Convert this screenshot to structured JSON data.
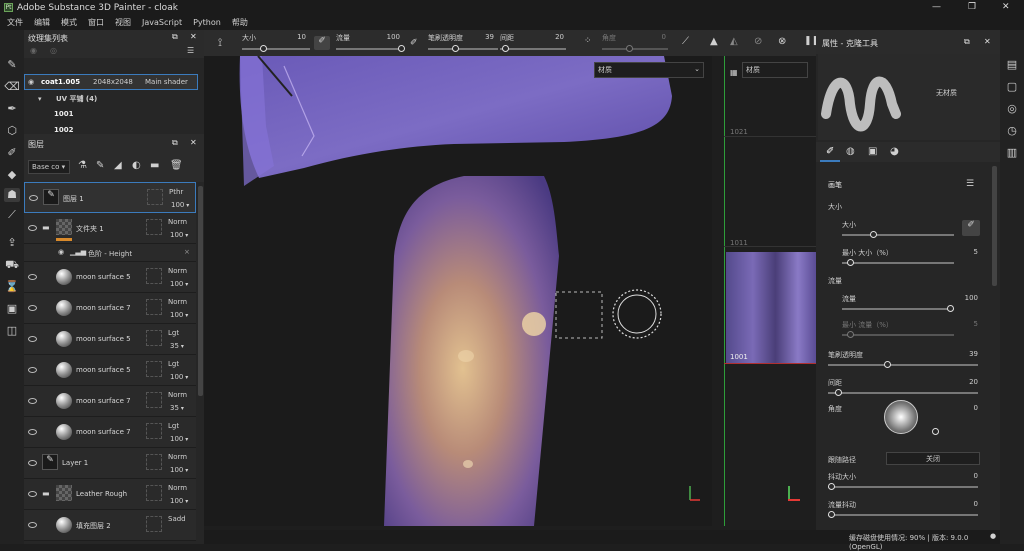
{
  "window": {
    "title": "Adobe Substance 3D Painter - cloak",
    "controls": [
      "—",
      "❐",
      "✕"
    ]
  },
  "menu": [
    "文件",
    "编辑",
    "模式",
    "窗口",
    "视图",
    "JavaScript",
    "Python",
    "帮助"
  ],
  "texture_set": {
    "title": "纹理集列表",
    "name": "coat1.005",
    "resolution": "2048x2048",
    "shader": "Main shader",
    "uv_label": "UV 平铺 (4)",
    "tiles": [
      "1001",
      "1002"
    ]
  },
  "layers_panel": {
    "title": "图层",
    "channel": "Base co",
    "layers": [
      {
        "name": "图层 1",
        "blend": "Pthr",
        "opacity": "100",
        "type": "paint"
      },
      {
        "name": "文件夹 1",
        "blend": "Norm",
        "opacity": "100",
        "type": "folder"
      },
      {
        "name": "色阶 - Height",
        "blend": "",
        "opacity": "",
        "type": "effect"
      },
      {
        "name": "moon surface 5",
        "blend": "Norm",
        "opacity": "100",
        "type": "fill"
      },
      {
        "name": "moon surface 7",
        "blend": "Norm",
        "opacity": "100",
        "type": "fill"
      },
      {
        "name": "moon surface 5",
        "blend": "Lgt",
        "opacity": "35",
        "type": "fill"
      },
      {
        "name": "moon surface 5",
        "blend": "Lgt",
        "opacity": "100",
        "type": "fill"
      },
      {
        "name": "moon surface 7",
        "blend": "Norm",
        "opacity": "35",
        "type": "fill"
      },
      {
        "name": "moon surface 7",
        "blend": "Lgt",
        "opacity": "100",
        "type": "fill"
      },
      {
        "name": "Layer 1",
        "blend": "Norm",
        "opacity": "100",
        "type": "paint"
      },
      {
        "name": "Leather Rough",
        "blend": "Norm",
        "opacity": "100",
        "type": "folder"
      },
      {
        "name": "填充图层 2",
        "blend": "Sadd",
        "opacity": "",
        "type": "fill"
      }
    ]
  },
  "toolbar": {
    "size_label": "大小",
    "size_value": "10",
    "flow_label": "流量",
    "flow_value": "100",
    "opacity_label": "笔刷透明度",
    "opacity_value": "39",
    "spacing_label": "间距",
    "spacing_value": "20",
    "angle_label": "角度",
    "angle_value": "0"
  },
  "viewport": {
    "material_dropdown": "材质",
    "uv_material": "材质",
    "uv_tiles": [
      "1021",
      "1011",
      "1001"
    ]
  },
  "properties": {
    "title": "属性 - 克隆工具",
    "no_material": "无材质",
    "section": "画笔",
    "size_group": "大小",
    "size_label": "大小",
    "size_value": "10",
    "size_fraction": 0.27,
    "min_size_label": "最小 大小（%）",
    "min_size_value": "5",
    "min_size_fraction": 0.05,
    "flow_group": "流量",
    "flow_label": "流量",
    "flow_value": "100",
    "flow_fraction": 1.0,
    "min_flow_label": "最小 流量（%）",
    "min_flow_value": "5",
    "min_flow_fraction": 0.05,
    "opacity_label": "笔刷透明度",
    "opacity_value": "39",
    "opacity_fraction": 0.39,
    "spacing_label": "间距",
    "spacing_value": "20",
    "spacing_fraction": 0.05,
    "angle_label": "角度",
    "angle_value": "0",
    "follow_label": "跟随路径",
    "follow_value": "关闭",
    "jitter_size_label": "抖动大小",
    "jitter_size_value": "0",
    "flow_jitter_label": "流量抖动",
    "flow_jitter_value": "0"
  },
  "status": "缓存磁盘使用情况: 90% | 版本: 9.0.0 (OpenGL)",
  "colors": {
    "accent": "#3b7bbd",
    "purple": "#6f5cc8",
    "orange": "#d98a2b"
  }
}
